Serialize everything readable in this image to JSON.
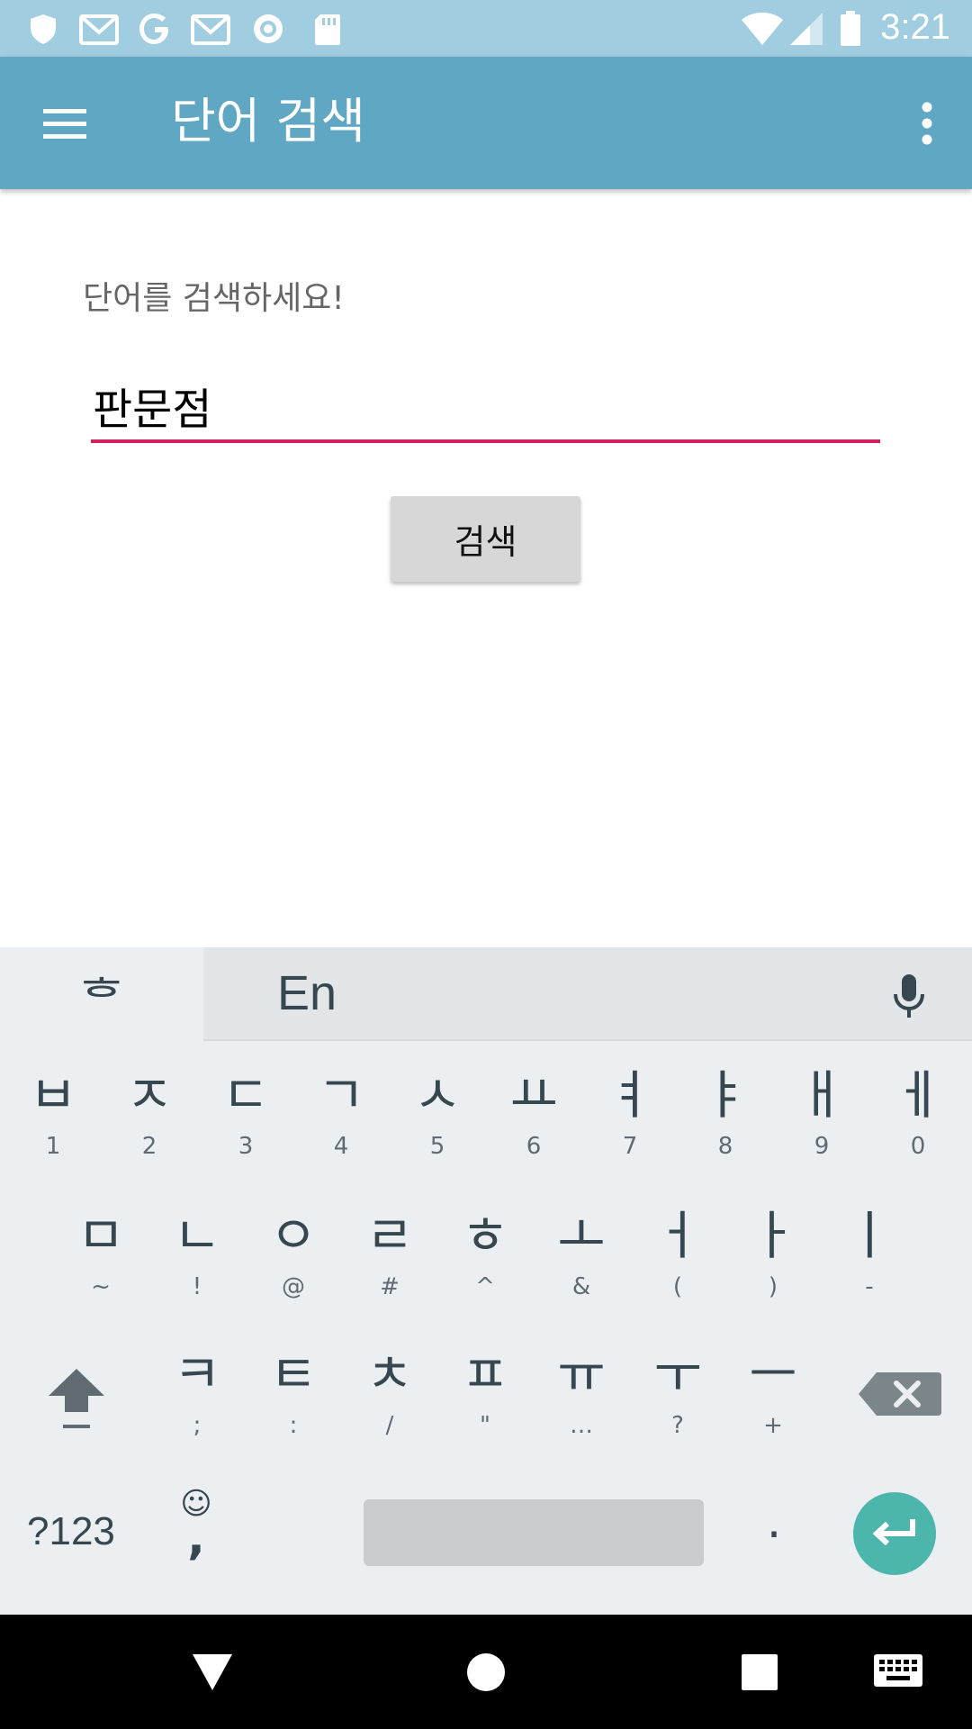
{
  "status_bar": {
    "time": "3:21",
    "icons": [
      "shield-icon",
      "gmail-icon",
      "google-icon",
      "gmail-icon",
      "record-icon",
      "sd-card-icon",
      "wifi-icon",
      "cell-signal-icon",
      "battery-icon"
    ]
  },
  "app_bar": {
    "title": "단어 검색",
    "menu_icon": "hamburger-menu-icon",
    "overflow_icon": "more-vert-icon",
    "color": "#60a7c4"
  },
  "content": {
    "prompt": "단어를 검색하세요!",
    "search_value": "판문점",
    "search_button_label": "검색",
    "accent_color": "#d1215f"
  },
  "keyboard": {
    "hangul_tab": "ᄒ",
    "lang_label": "En",
    "rows": [
      [
        {
          "main": "ㅂ",
          "sub": "1"
        },
        {
          "main": "ㅈ",
          "sub": "2"
        },
        {
          "main": "ㄷ",
          "sub": "3"
        },
        {
          "main": "ㄱ",
          "sub": "4"
        },
        {
          "main": "ㅅ",
          "sub": "5"
        },
        {
          "main": "ㅛ",
          "sub": "6"
        },
        {
          "main": "ㅕ",
          "sub": "7"
        },
        {
          "main": "ㅑ",
          "sub": "8"
        },
        {
          "main": "ㅐ",
          "sub": "9"
        },
        {
          "main": "ㅔ",
          "sub": "0"
        }
      ],
      [
        {
          "main": "ㅁ",
          "sub": "~"
        },
        {
          "main": "ㄴ",
          "sub": "!"
        },
        {
          "main": "ㅇ",
          "sub": "@"
        },
        {
          "main": "ㄹ",
          "sub": "#"
        },
        {
          "main": "ㅎ",
          "sub": "^"
        },
        {
          "main": "ㅗ",
          "sub": "&"
        },
        {
          "main": "ㅓ",
          "sub": "("
        },
        {
          "main": "ㅏ",
          "sub": ")"
        },
        {
          "main": "ㅣ",
          "sub": "-"
        }
      ],
      [
        {
          "main": "ㅋ",
          "sub": ";"
        },
        {
          "main": "ㅌ",
          "sub": ":"
        },
        {
          "main": "ㅊ",
          "sub": "/"
        },
        {
          "main": "ㅍ",
          "sub": "\""
        },
        {
          "main": "ㅠ",
          "sub": "…"
        },
        {
          "main": "ㅜ",
          "sub": "?"
        },
        {
          "main": "ㅡ",
          "sub": "+"
        }
      ]
    ],
    "symbols_label": "?123",
    "comma_label": ",",
    "emoji_label": "☺",
    "period_label": ".",
    "enter_color": "#4db6ac"
  },
  "nav_bar": {
    "icons": [
      "back-icon",
      "home-icon",
      "recents-icon",
      "keyboard-switch-icon"
    ]
  }
}
